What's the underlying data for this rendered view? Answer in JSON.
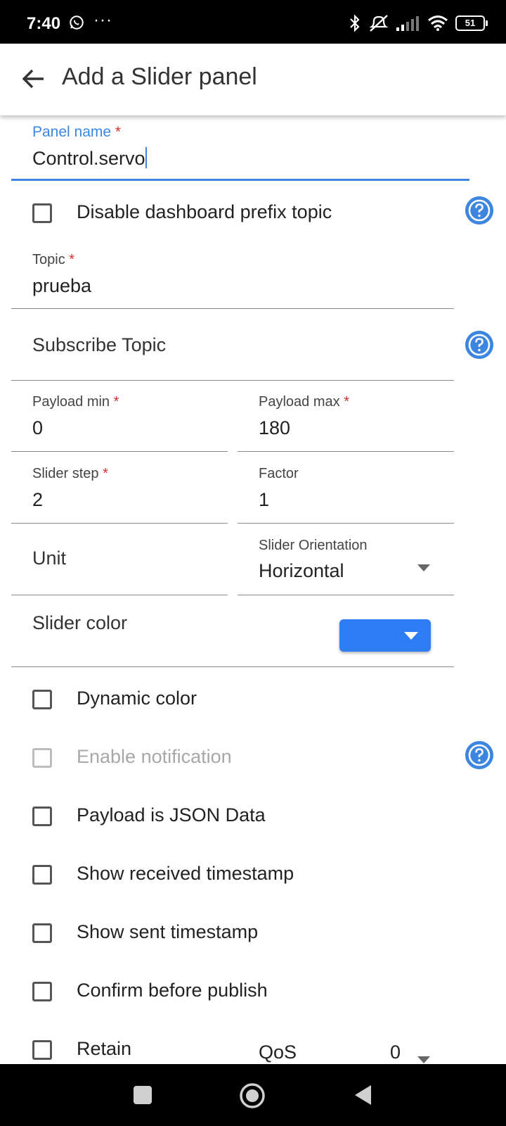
{
  "status": {
    "time": "7:40",
    "battery": "51",
    "more": "···"
  },
  "appbar": {
    "title": "Add a Slider panel"
  },
  "form": {
    "panel_name": {
      "label": "Panel name",
      "required": "*",
      "value": "Control.servo"
    },
    "disable_prefix": {
      "label": "Disable dashboard prefix topic"
    },
    "topic": {
      "label": "Topic",
      "required": "*",
      "value": "prueba"
    },
    "subscribe_topic": {
      "placeholder": "Subscribe Topic"
    },
    "payload_min": {
      "label": "Payload min",
      "required": "*",
      "value": "0"
    },
    "payload_max": {
      "label": "Payload max",
      "required": "*",
      "value": "180"
    },
    "slider_step": {
      "label": "Slider step",
      "required": "*",
      "value": "2"
    },
    "factor": {
      "label": "Factor",
      "value": "1"
    },
    "unit": {
      "placeholder": "Unit"
    },
    "orientation": {
      "label": "Slider Orientation",
      "value": "Horizontal"
    },
    "slider_color": {
      "label": "Slider color",
      "color": "#2f7df4"
    },
    "dynamic_color": {
      "label": "Dynamic color"
    },
    "enable_notification": {
      "label": "Enable notification"
    },
    "payload_json": {
      "label": "Payload is JSON Data"
    },
    "show_received_ts": {
      "label": "Show received timestamp"
    },
    "show_sent_ts": {
      "label": "Show sent timestamp"
    },
    "confirm_publish": {
      "label": "Confirm before publish"
    },
    "retain": {
      "label": "Retain"
    },
    "qos": {
      "label": "QoS",
      "value": "0"
    }
  },
  "colors": {
    "accent": "#3d86e0",
    "required": "#d32f2f"
  }
}
